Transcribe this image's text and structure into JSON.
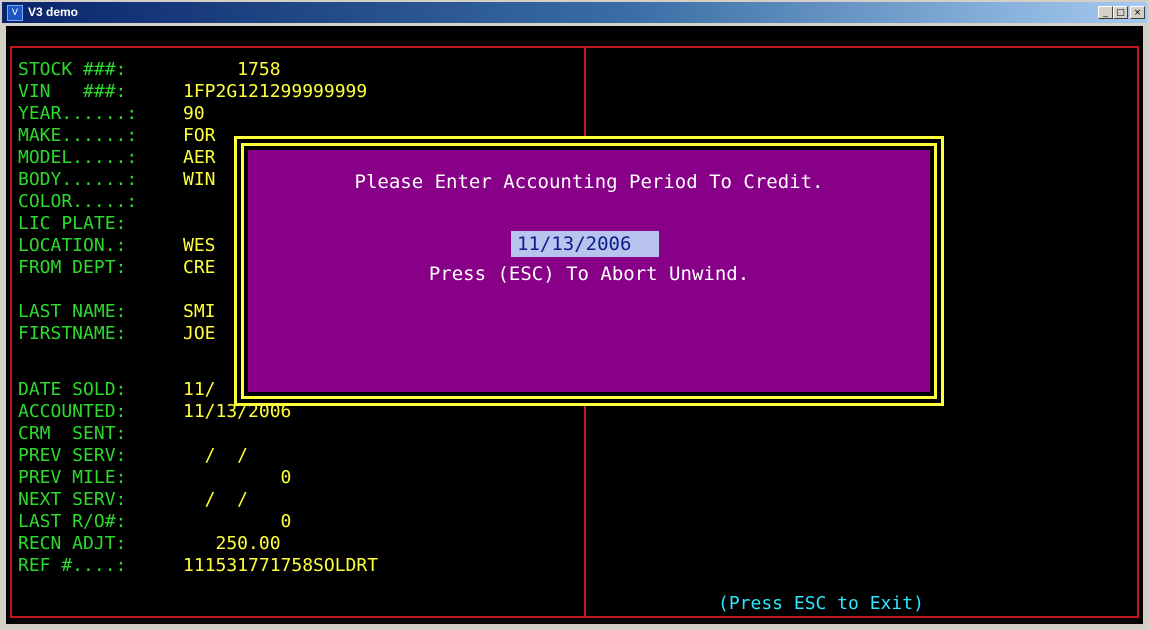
{
  "window": {
    "title": "V3 demo",
    "icon_name": "app-icon",
    "controls": {
      "minimize": "_",
      "maximize": "□",
      "close": "×"
    }
  },
  "colors": {
    "label": "#2ed92e",
    "value": "#ffff3c",
    "frame": "#c0161c",
    "dialog_bg": "#880088",
    "dialog_border": "#ffff3c",
    "hint": "#2ee6ff"
  },
  "fields": [
    {
      "label": "STOCK ###:",
      "value": "     1758"
    },
    {
      "label": "VIN   ###:",
      "value": "1FP2G121299999999"
    },
    {
      "label": "YEAR......:",
      "value": "90"
    },
    {
      "label": "MAKE......:",
      "value": "FOR"
    },
    {
      "label": "MODEL.....:",
      "value": "AER"
    },
    {
      "label": "BODY......:",
      "value": "WIN"
    },
    {
      "label": "COLOR.....:",
      "value": ""
    },
    {
      "label": "LIC PLATE:",
      "value": ""
    },
    {
      "label": "LOCATION.:",
      "value": "WES"
    },
    {
      "label": "FROM DEPT:",
      "value": "CRE"
    },
    {
      "label": "LAST NAME:",
      "value": "SMI"
    },
    {
      "label": "FIRSTNAME:",
      "value": "JOE"
    },
    {
      "label": "DATE SOLD:",
      "value": "11/"
    },
    {
      "label": "ACCOUNTED:",
      "value": "11/13/2006"
    },
    {
      "label": "CRM  SENT:",
      "value": ""
    },
    {
      "label": "PREV SERV:",
      "value": "  /  /"
    },
    {
      "label": "PREV MILE:",
      "value": "         0"
    },
    {
      "label": "NEXT SERV:",
      "value": "  /  /"
    },
    {
      "label": "LAST R/O#:",
      "value": "         0"
    },
    {
      "label": "RECN ADJT:",
      "value": "   250.00"
    },
    {
      "label": "REF #....:",
      "value": "111531771758SOLDRT"
    }
  ],
  "dialog": {
    "prompt": "Please Enter Accounting Period To Credit.",
    "date_value": "11/13/2006",
    "abort_text": "Press (ESC) To Abort Unwind."
  },
  "footer": {
    "esc_hint": "(Press ESC to Exit)"
  }
}
